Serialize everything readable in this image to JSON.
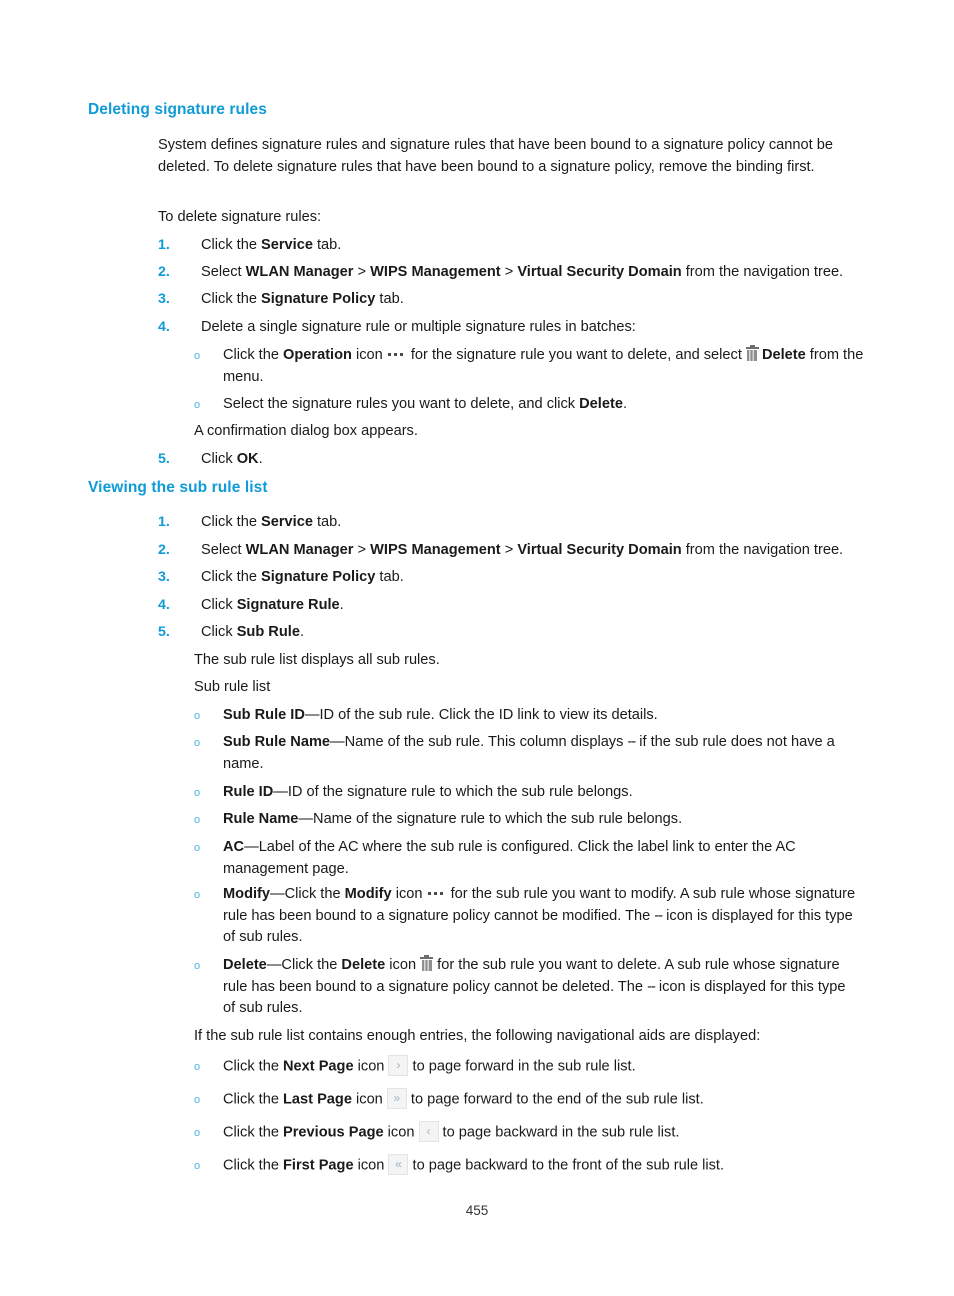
{
  "document": {
    "page_number": "455"
  },
  "sections": {
    "deleting": {
      "heading": "Deleting signature rules",
      "intro": {
        "p1": "System defines signature rules and signature rules that have been bound to a signature policy cannot be deleted. To delete signature rules that have been bound to a signature policy, remove the binding first.",
        "p2": "To delete signature rules:"
      },
      "steps": [
        {
          "num": "1.",
          "parts": [
            {
              "t": "Click the ",
              "b": false
            },
            {
              "t": "Service",
              "b": true
            },
            {
              "t": " tab.",
              "b": false
            }
          ]
        },
        {
          "num": "2.",
          "parts": [
            {
              "t": "Select ",
              "b": false
            },
            {
              "t": "WLAN Manager",
              "b": true
            },
            {
              "t": " > ",
              "b": false
            },
            {
              "t": "WIPS Management",
              "b": true
            },
            {
              "t": " > ",
              "b": false
            },
            {
              "t": "Virtual Security Domain",
              "b": true
            },
            {
              "t": " from the navigation tree.",
              "b": false
            }
          ]
        },
        {
          "num": "3.",
          "parts": [
            {
              "t": "Click the ",
              "b": false
            },
            {
              "t": "Signature Policy",
              "b": true
            },
            {
              "t": " tab.",
              "b": false
            }
          ]
        },
        {
          "num": "4.",
          "parts": [
            {
              "t": "Delete a single signature rule or multiple signature rules in batches:",
              "b": false
            }
          ]
        },
        {
          "num": "5.",
          "parts": [
            {
              "t": "Click ",
              "b": false
            },
            {
              "t": "OK",
              "b": true
            },
            {
              "t": ".",
              "b": false
            }
          ]
        }
      ],
      "sub_bullets": {
        "bullet_marker": "o",
        "operation": {
          "pre": "Click the ",
          "bold1": "Operation",
          "mid1": " icon ",
          "icon1": "ellipsis-icon",
          "mid2": " for the signature rule you want to delete, and select ",
          "icon2": "trash-icon",
          "bold2": "Delete",
          "post": " from the menu."
        },
        "select_rules": {
          "pre": "Select the signature rules you want to delete, and click ",
          "bold": "Delete",
          "post": "."
        }
      },
      "confirmation": "A confirmation dialog box appears."
    },
    "viewing": {
      "heading": "Viewing the sub rule list",
      "steps": [
        {
          "num": "1.",
          "parts": [
            {
              "t": "Click the ",
              "b": false
            },
            {
              "t": "Service",
              "b": true
            },
            {
              "t": " tab.",
              "b": false
            }
          ]
        },
        {
          "num": "2.",
          "parts": [
            {
              "t": "Select ",
              "b": false
            },
            {
              "t": "WLAN Manager",
              "b": true
            },
            {
              "t": " > ",
              "b": false
            },
            {
              "t": "WIPS Management",
              "b": true
            },
            {
              "t": " > ",
              "b": false
            },
            {
              "t": "Virtual Security Domain",
              "b": true
            },
            {
              "t": " from the navigation tree.",
              "b": false
            }
          ]
        },
        {
          "num": "3.",
          "parts": [
            {
              "t": "Click the ",
              "b": false
            },
            {
              "t": "Signature Policy",
              "b": true
            },
            {
              "t": " tab.",
              "b": false
            }
          ]
        },
        {
          "num": "4.",
          "parts": [
            {
              "t": "Click ",
              "b": false
            },
            {
              "t": "Signature Rule",
              "b": true
            },
            {
              "t": ".",
              "b": false
            }
          ]
        },
        {
          "num": "5.",
          "parts": [
            {
              "t": "Click ",
              "b": false
            },
            {
              "t": "Sub Rule",
              "b": true
            },
            {
              "t": ".",
              "b": false
            }
          ]
        }
      ],
      "after_steps": {
        "line1": "The sub rule list displays all sub rules.",
        "line2": "Sub rule list"
      },
      "field_bullets": [
        {
          "term": "Sub Rule ID",
          "desc": "—ID of the sub rule. Click the ID link to view its details."
        },
        {
          "term": "Sub Rule Name",
          "desc_pre": "—Name of the sub rule. This column displays ",
          "dash": "--",
          "desc_post": " if the sub rule does not have a name."
        },
        {
          "term": "Rule ID",
          "desc": "—ID of the signature rule to which the sub rule belongs."
        },
        {
          "term": "Rule Name",
          "desc": "—Name of the signature rule to which the sub rule belongs."
        },
        {
          "term": "AC",
          "desc": "—Label of the AC where the sub rule is configured. Click the label link to enter the AC management page."
        }
      ],
      "modify_bullet": {
        "term": "Modify",
        "pre": "—Click the ",
        "bold": "Modify",
        "mid": " icon ",
        "icon": "ellipsis-icon",
        "post1": " for the sub rule you want to modify. A sub rule whose signature rule has been bound to a signature policy cannot be modified. The ",
        "dash": "--",
        "post2": " icon is displayed for this type of sub rules."
      },
      "delete_bullet": {
        "term": "Delete",
        "pre": "—Click the ",
        "bold": "Delete",
        "mid": " icon ",
        "icon": "trash-icon",
        "post1": " for the sub rule you want to delete. A sub rule whose signature rule has been bound to a signature policy cannot be deleted. The ",
        "dash": "--",
        "post2": " icon is displayed for this type of sub rules."
      },
      "nav_aids_intro": "If the sub rule list contains enough entries, the following navigational aids are displayed:",
      "nav_aids": [
        {
          "pre": "Click the ",
          "term": "Next Page",
          "mid": " icon ",
          "glyph": "›",
          "icon_name": "next-page-icon",
          "post": " to page forward in the sub rule list."
        },
        {
          "pre": "Click the ",
          "term": "Last Page",
          "mid": " icon ",
          "glyph": "»",
          "icon_name": "last-page-icon",
          "post": " to page forward to the end of the sub rule list."
        },
        {
          "pre": "Click the ",
          "term": "Previous Page",
          "mid": " icon ",
          "glyph": "‹",
          "icon_name": "previous-page-icon",
          "post": " to page backward in the sub rule list."
        },
        {
          "pre": "Click the ",
          "term": "First Page",
          "mid": " icon ",
          "glyph": "«",
          "icon_name": "first-page-icon",
          "post": " to page backward to the front of the sub rule list."
        }
      ]
    }
  },
  "colors": {
    "heading_blue": "#0f9bd7",
    "number_blue": "#0f9bd7",
    "bullet_blue": "#49b6e4",
    "body_text": "#1a1a1a"
  }
}
